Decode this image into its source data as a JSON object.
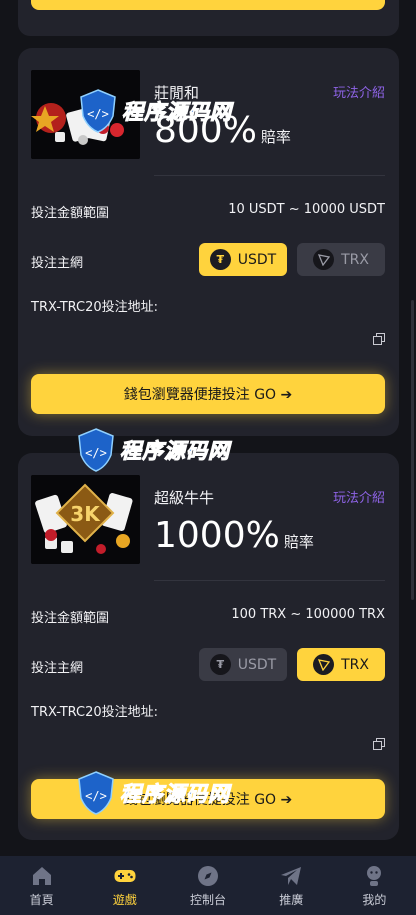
{
  "games": [
    {
      "name": "莊閒和",
      "guide_label": "玩法介紹",
      "odds": "800%",
      "odds_label": "賠率",
      "range_label": "投注金額範圍",
      "range_value": "10 USDT ~ 10000 USDT",
      "network_label": "投注主網",
      "networks": [
        {
          "label": "USDT",
          "icon": "tether-icon",
          "selected": true
        },
        {
          "label": "TRX",
          "icon": "tron-icon",
          "selected": false
        }
      ],
      "address_label": "TRX-TRC20投注地址:",
      "go_label": "錢包瀏覽器便捷投注 GO ➔"
    },
    {
      "name": "超級牛牛",
      "guide_label": "玩法介紹",
      "odds": "1000%",
      "odds_label": "賠率",
      "range_label": "投注金額範圍",
      "range_value": "100 TRX ~ 100000 TRX",
      "network_label": "投注主網",
      "networks": [
        {
          "label": "USDT",
          "icon": "tether-icon",
          "selected": false
        },
        {
          "label": "TRX",
          "icon": "tron-icon",
          "selected": true
        }
      ],
      "address_label": "TRX-TRC20投注地址:",
      "go_label": "錢包瀏覽器便捷投注 GO ➔",
      "thumb_text": "3K"
    }
  ],
  "watermark": {
    "part1": "程序",
    "part2": "源码网"
  },
  "nav": [
    {
      "label": "首頁",
      "icon": "home-icon",
      "active": false
    },
    {
      "label": "遊戲",
      "icon": "gamepad-icon",
      "active": true
    },
    {
      "label": "控制台",
      "icon": "compass-icon",
      "active": false
    },
    {
      "label": "推廣",
      "icon": "paper-plane-icon",
      "active": false
    },
    {
      "label": "我的",
      "icon": "user-icon",
      "active": false
    }
  ],
  "colors": {
    "accent": "#ffd33d",
    "background": "#131419",
    "card": "#22232c",
    "link": "#8e63e6"
  }
}
